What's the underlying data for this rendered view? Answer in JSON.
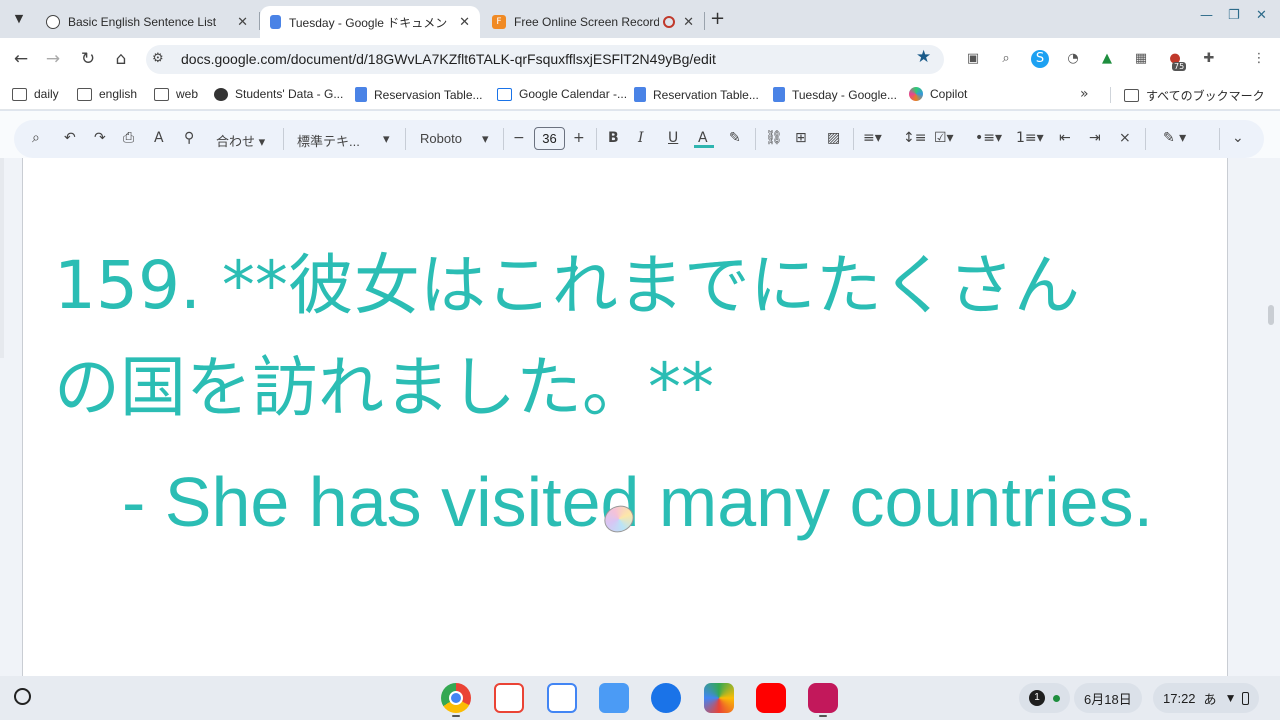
{
  "tabs": [
    {
      "title": "Basic English Sentence List",
      "favicon": "openai-icon",
      "active": false
    },
    {
      "title": "Tuesday - Google ドキュメント",
      "favicon": "docs-icon",
      "active": true
    },
    {
      "title": "Free Online Screen Recorder",
      "favicon": "recorder-icon",
      "active": false
    }
  ],
  "address": {
    "url": "docs.google.com/document/d/18GWvLA7KZflt6TALK-qrFsquxfflsxjESFlT2N49yBg/edit"
  },
  "extensions": {
    "badge": "75"
  },
  "bookmarks": {
    "items": [
      {
        "label": "daily"
      },
      {
        "label": "english"
      },
      {
        "label": "web"
      },
      {
        "label": "Students' Data - G..."
      },
      {
        "label": "Reservasion Table..."
      },
      {
        "label": "Google Calendar -..."
      },
      {
        "label": "Reservation Table..."
      },
      {
        "label": "Tuesday - Google..."
      },
      {
        "label": "Copilot"
      }
    ],
    "all_bookmarks": "すべてのブックマーク"
  },
  "docs_toolbar": {
    "zoom": "合わせ",
    "style": "標準テキ...",
    "font": "Roboto",
    "font_size": "36"
  },
  "document": {
    "line1": "159. **彼女はこれまでにたくさん",
    "line2": "の国を訪れました。**",
    "line3": "- She has visited many countries.",
    "text_color": "#2bbdb4"
  },
  "shelf": {
    "notification_count": "1",
    "date": "6月18日",
    "time": "17:22",
    "ime": "あ"
  }
}
